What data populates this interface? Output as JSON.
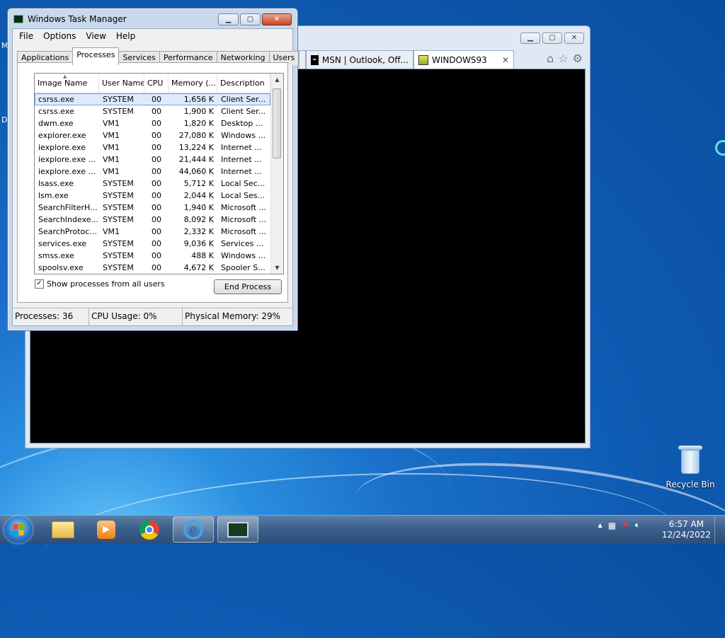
{
  "desktop": {
    "edge_letters": [
      "M",
      "D"
    ],
    "recycle_bin_label": "Recycle Bin"
  },
  "browser": {
    "tabs": [
      {
        "label": "MSN | Outlook, Off..."
      },
      {
        "label": "WINDOWS93"
      }
    ],
    "close_glyph": "✕"
  },
  "task_manager": {
    "title": "Windows Task Manager",
    "menu": [
      "File",
      "Options",
      "View",
      "Help"
    ],
    "tabs": [
      "Applications",
      "Processes",
      "Services",
      "Performance",
      "Networking",
      "Users"
    ],
    "active_tab": "Processes",
    "columns": [
      "Image Name",
      "User Name",
      "CPU",
      "Memory (...",
      "Description"
    ],
    "rows": [
      {
        "name": "csrss.exe",
        "user": "SYSTEM",
        "cpu": "00",
        "mem": "1,656 K",
        "desc": "Client Ser..."
      },
      {
        "name": "csrss.exe",
        "user": "SYSTEM",
        "cpu": "00",
        "mem": "1,900 K",
        "desc": "Client Ser..."
      },
      {
        "name": "dwm.exe",
        "user": "VM1",
        "cpu": "00",
        "mem": "1,820 K",
        "desc": "Desktop ..."
      },
      {
        "name": "explorer.exe",
        "user": "VM1",
        "cpu": "00",
        "mem": "27,080 K",
        "desc": "Windows ..."
      },
      {
        "name": "iexplore.exe",
        "user": "VM1",
        "cpu": "00",
        "mem": "13,224 K",
        "desc": "Internet ..."
      },
      {
        "name": "iexplore.exe ...",
        "user": "VM1",
        "cpu": "00",
        "mem": "21,444 K",
        "desc": "Internet ..."
      },
      {
        "name": "iexplore.exe ...",
        "user": "VM1",
        "cpu": "00",
        "mem": "44,060 K",
        "desc": "Internet ..."
      },
      {
        "name": "lsass.exe",
        "user": "SYSTEM",
        "cpu": "00",
        "mem": "5,712 K",
        "desc": "Local Sec..."
      },
      {
        "name": "lsm.exe",
        "user": "SYSTEM",
        "cpu": "00",
        "mem": "2,044 K",
        "desc": "Local Ses..."
      },
      {
        "name": "SearchFilterH...",
        "user": "SYSTEM",
        "cpu": "00",
        "mem": "1,940 K",
        "desc": "Microsoft ..."
      },
      {
        "name": "SearchIndexe...",
        "user": "SYSTEM",
        "cpu": "00",
        "mem": "8,092 K",
        "desc": "Microsoft ..."
      },
      {
        "name": "SearchProtoc...",
        "user": "VM1",
        "cpu": "00",
        "mem": "2,332 K",
        "desc": "Microsoft ..."
      },
      {
        "name": "services.exe",
        "user": "SYSTEM",
        "cpu": "00",
        "mem": "9,036 K",
        "desc": "Services ..."
      },
      {
        "name": "smss.exe",
        "user": "SYSTEM",
        "cpu": "00",
        "mem": "488 K",
        "desc": "Windows ..."
      },
      {
        "name": "spoolsv.exe",
        "user": "SYSTEM",
        "cpu": "00",
        "mem": "4,672 K",
        "desc": "Spooler S..."
      }
    ],
    "selected_row": 0,
    "show_all_label": "Show processes from all users",
    "show_all_checked": true,
    "end_process_label": "End Process",
    "status": {
      "processes": "Processes: 36",
      "cpu": "CPU Usage: 0%",
      "memory": "Physical Memory: 29%"
    }
  },
  "taskbar": {
    "time": "6:57 AM",
    "date": "12/24/2022",
    "tray_arrow": "▲"
  }
}
